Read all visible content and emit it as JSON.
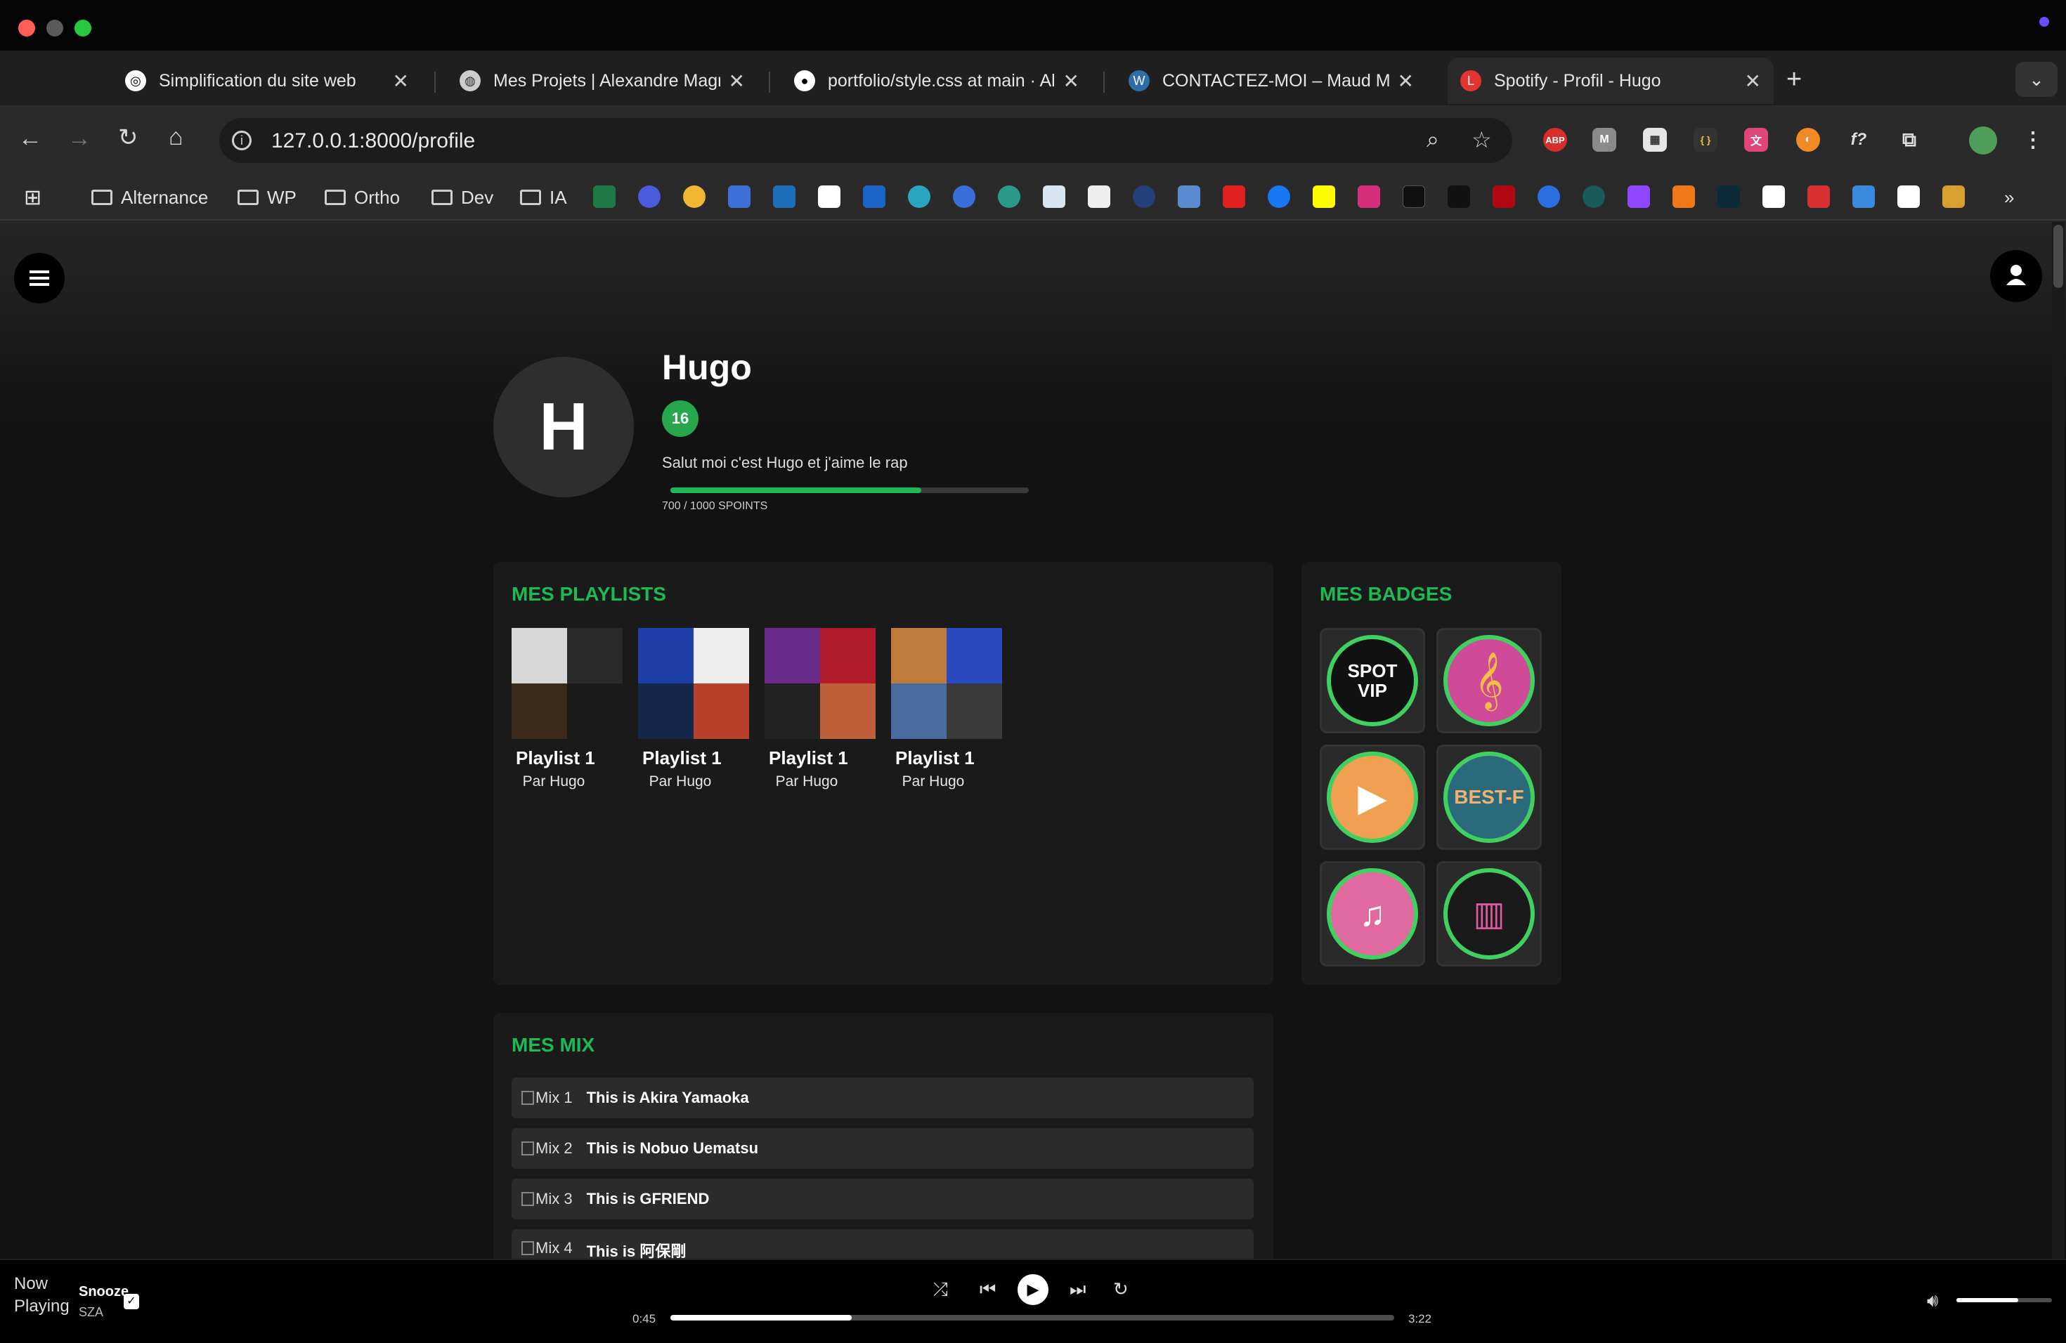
{
  "browser": {
    "tabs": [
      {
        "title": "Simplification du site web",
        "active": false
      },
      {
        "title": "Mes Projets | Alexandre Magn",
        "active": false
      },
      {
        "title": "portfolio/style.css at main · Al",
        "active": false
      },
      {
        "title": "CONTACTEZ-MOI – Maud Ma",
        "active": false
      },
      {
        "title": "Spotify - Profil - Hugo",
        "active": true
      }
    ],
    "new_tab": "+",
    "url": "127.0.0.1:8000/profile",
    "extensions": [
      "ABP",
      "M",
      "{ }",
      "f?"
    ],
    "bookmarks": [
      "Alternance",
      "WP",
      "Ortho",
      "Dev",
      "IA"
    ],
    "more_bookmarks": "»"
  },
  "profile": {
    "initial": "H",
    "name": "Hugo",
    "level": "16",
    "bio": "Salut moi c'est Hugo et j'aime le rap",
    "xp_text": "700 / 1000 SPOINTS",
    "xp_fraction": 0.7
  },
  "playlists": {
    "title": "MES PLAYLISTS",
    "items": [
      {
        "name": "Playlist 1",
        "owner": "Par Hugo"
      },
      {
        "name": "Playlist 1",
        "owner": "Par Hugo"
      },
      {
        "name": "Playlist 1",
        "owner": "Par Hugo"
      },
      {
        "name": "Playlist 1",
        "owner": "Par Hugo"
      }
    ]
  },
  "badges": {
    "title": "MES BADGES",
    "items": [
      {
        "label": "SPOT VIP",
        "icon": "spot-vip-badge-icon"
      },
      {
        "label": "",
        "icon": "treble-clef-badge-icon"
      },
      {
        "label": "",
        "icon": "tap-play-badge-icon"
      },
      {
        "label": "BEST-F",
        "icon": "best-badge-icon"
      },
      {
        "label": "",
        "icon": "phone-music-badge-icon"
      },
      {
        "label": "",
        "icon": "equalizer-badge-icon"
      }
    ]
  },
  "mixes": {
    "title": "MES MIX",
    "items": [
      {
        "alt": "Mix 1",
        "title": "This is Akira Yamaoka"
      },
      {
        "alt": "Mix 2",
        "title": "This is Nobuo Uematsu"
      },
      {
        "alt": "Mix 3",
        "title": "This is GFRIEND"
      },
      {
        "alt": "Mix 4",
        "title": "This is 阿保剛"
      }
    ]
  },
  "player": {
    "now_playing_alt": "Now Playing",
    "track": "Snooze",
    "artist": "SZA",
    "elapsed": "0:45",
    "duration": "3:22",
    "progress": 0.25,
    "volume": 0.65,
    "accent": "#1db954"
  }
}
